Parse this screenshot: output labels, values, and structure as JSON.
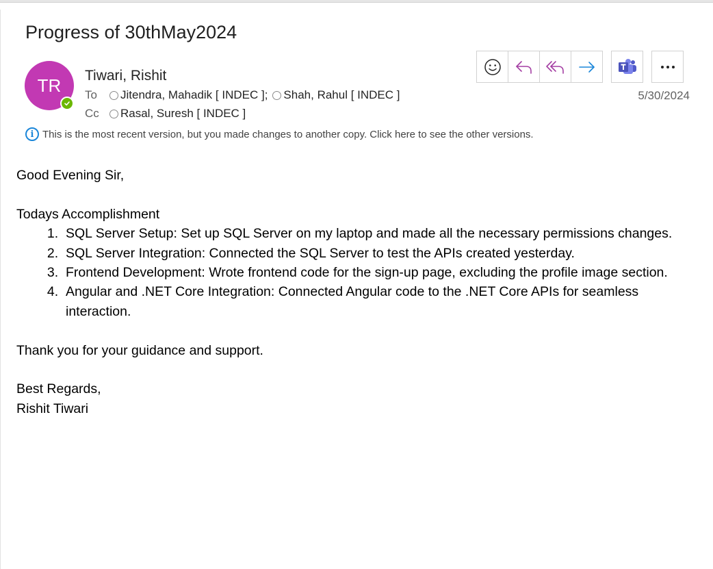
{
  "email": {
    "subject": "Progress of 30thMay2024",
    "sender": {
      "initials": "TR",
      "name": "Tiwari, Rishit",
      "avatar_color": "#c239b3",
      "presence": "available",
      "presence_color": "#6bb700"
    },
    "to_label": "To",
    "to": [
      "Jitendra, Mahadik [ INDEC ];",
      "Shah, Rahul [ INDEC ]"
    ],
    "cc_label": "Cc",
    "cc": [
      "Rasal, Suresh [ INDEC ]"
    ],
    "date": "5/30/2024",
    "info_message": "This is the most recent version, but you made changes to another copy. Click here to see the other versions.",
    "actions": [
      {
        "name": "react",
        "icon": "smiley-icon"
      },
      {
        "name": "reply",
        "icon": "reply-icon"
      },
      {
        "name": "reply-all",
        "icon": "reply-all-icon"
      },
      {
        "name": "forward",
        "icon": "forward-icon"
      },
      {
        "name": "teams",
        "icon": "teams-icon"
      },
      {
        "name": "more",
        "icon": "more-icon"
      }
    ],
    "body": {
      "greeting": "Good Evening Sir,",
      "section_title": "Todays Accomplishment",
      "items": [
        "SQL Server Setup: Set up SQL Server on my laptop and made all the necessary permissions changes.",
        "SQL Server Integration: Connected the SQL Server to test the APIs created yesterday.",
        "Frontend Development: Wrote frontend code for the sign-up page, excluding the profile image section.",
        "Angular and .NET Core Integration: Connected Angular code to the .NET Core APIs for seamless interaction."
      ],
      "thanks": "Thank you for your guidance and support.",
      "closing": "Best Regards,",
      "signature": "Rishit Tiwari"
    }
  },
  "colors": {
    "accent_purple": "#a43fa3",
    "accent_blue": "#1a86d9",
    "teams_purple": "#5059c9"
  }
}
